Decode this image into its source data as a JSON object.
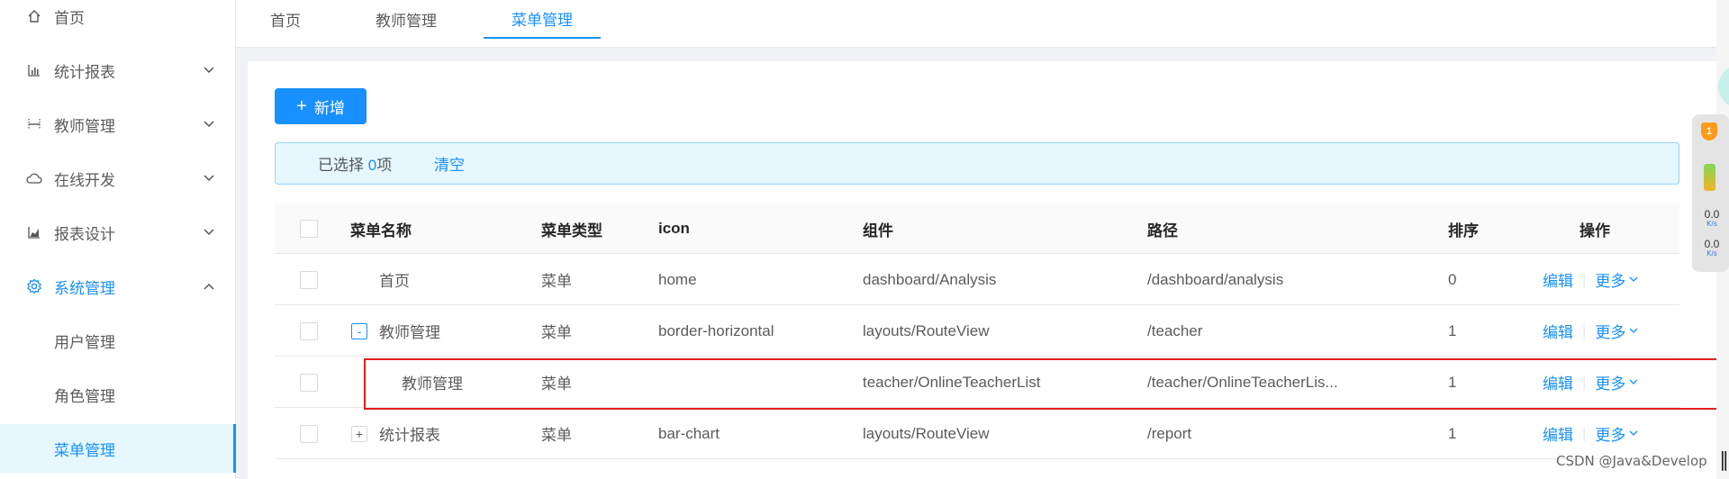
{
  "sidebar": {
    "items": [
      {
        "label": "首页",
        "icon": "home-icon"
      },
      {
        "label": "统计报表",
        "icon": "bar-chart-icon"
      },
      {
        "label": "教师管理",
        "icon": "border-horizontal-icon"
      },
      {
        "label": "在线开发",
        "icon": "cloud-icon"
      },
      {
        "label": "报表设计",
        "icon": "area-chart-icon"
      },
      {
        "label": "系统管理",
        "icon": "setting-icon"
      },
      {
        "label": "用户管理"
      },
      {
        "label": "角色管理"
      },
      {
        "label": "菜单管理"
      }
    ]
  },
  "tabs": [
    {
      "label": "首页"
    },
    {
      "label": "教师管理"
    },
    {
      "label": "菜单管理"
    }
  ],
  "toolbar": {
    "add_plus": "+",
    "add_label": "新增"
  },
  "alert": {
    "prefix": "已选择 ",
    "count": "0",
    "suffix": "项",
    "clear_label": "清空"
  },
  "table": {
    "columns": [
      "菜单名称",
      "菜单类型",
      "icon",
      "组件",
      "路径",
      "排序",
      "操作"
    ],
    "rows": [
      {
        "name": "首页",
        "type": "菜单",
        "icon": "home",
        "component": "dashboard/Analysis",
        "path": "/dashboard/analysis",
        "sort": "0",
        "expander": ""
      },
      {
        "name": "教师管理",
        "type": "菜单",
        "icon": "border-horizontal",
        "component": "layouts/RouteView",
        "path": "/teacher",
        "sort": "1",
        "expander": "-"
      },
      {
        "name": "教师管理",
        "type": "菜单",
        "icon": "",
        "component": "teacher/OnlineTeacherList",
        "path": "/teacher/OnlineTeacherLis...",
        "sort": "1",
        "expander": ""
      },
      {
        "name": "统计报表",
        "type": "菜单",
        "icon": "bar-chart",
        "component": "layouts/RouteView",
        "path": "/report",
        "sort": "1",
        "expander": "+"
      }
    ],
    "action_edit": "编辑",
    "action_sep": "|",
    "action_more": "更多"
  },
  "widget": {
    "badge": "1",
    "up_value": "0.0",
    "up_unit": "K/s",
    "down_value": "0.0",
    "down_unit": "K/s"
  },
  "watermark": "CSDN @Java&Develop",
  "corner_glyph": "∥",
  "colors": {
    "primary": "#1890ff",
    "highlight": "#e02020"
  }
}
